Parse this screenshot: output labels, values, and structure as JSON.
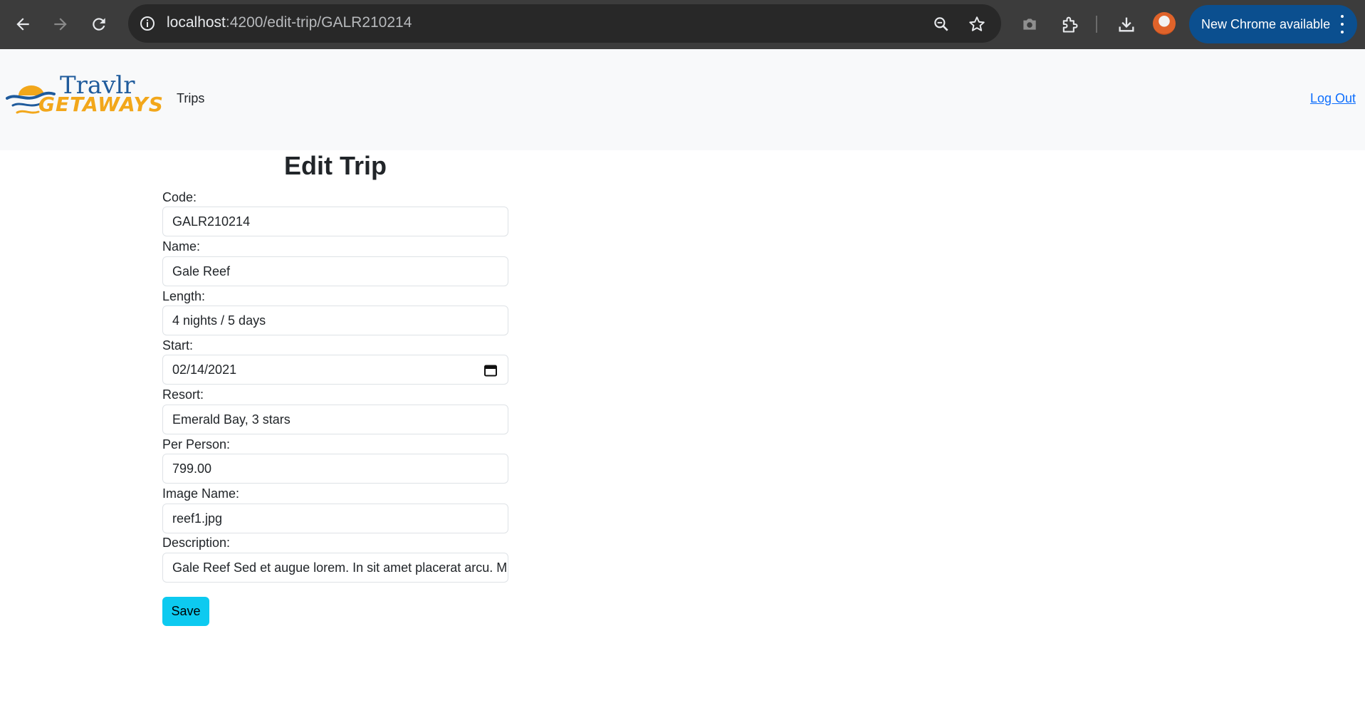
{
  "browser": {
    "url_host": "localhost",
    "url_path": ":4200/edit-trip/GALR210214",
    "update_label": "New Chrome available",
    "icons": [
      "back-arrow-icon",
      "forward-arrow-icon",
      "reload-icon",
      "info-icon",
      "zoom-icon",
      "star-icon",
      "camera-icon",
      "extensions-icon",
      "download-icon",
      "more-vert-icon"
    ]
  },
  "navbar": {
    "logo_top": "Travlr",
    "logo_bottom": "GETAWAYS",
    "trips_link": "Trips",
    "logout_link": "Log Out"
  },
  "form": {
    "title": "Edit Trip",
    "fields": [
      {
        "label": "Code:",
        "value": "GALR210214"
      },
      {
        "label": "Name:",
        "value": "Gale Reef"
      },
      {
        "label": "Length:",
        "value": "4 nights / 5 days"
      },
      {
        "label": "Start:",
        "value": "02/14/2021"
      },
      {
        "label": "Resort:",
        "value": "Emerald Bay, 3 stars"
      },
      {
        "label": "Per Person:",
        "value": "799.00"
      },
      {
        "label": "Image Name:",
        "value": "reef1.jpg"
      },
      {
        "label": "Description:",
        "value": "Gale Reef Sed et augue lorem. In sit amet placerat arcu. M"
      }
    ],
    "save_label": "Save"
  },
  "colors": {
    "chrome_bg": "#3c3c3c",
    "navbar_bg": "#f8f9fa",
    "save_button": "#0dcaf0",
    "link": "#0d6efd",
    "update_pill": "#0b4f8f"
  }
}
